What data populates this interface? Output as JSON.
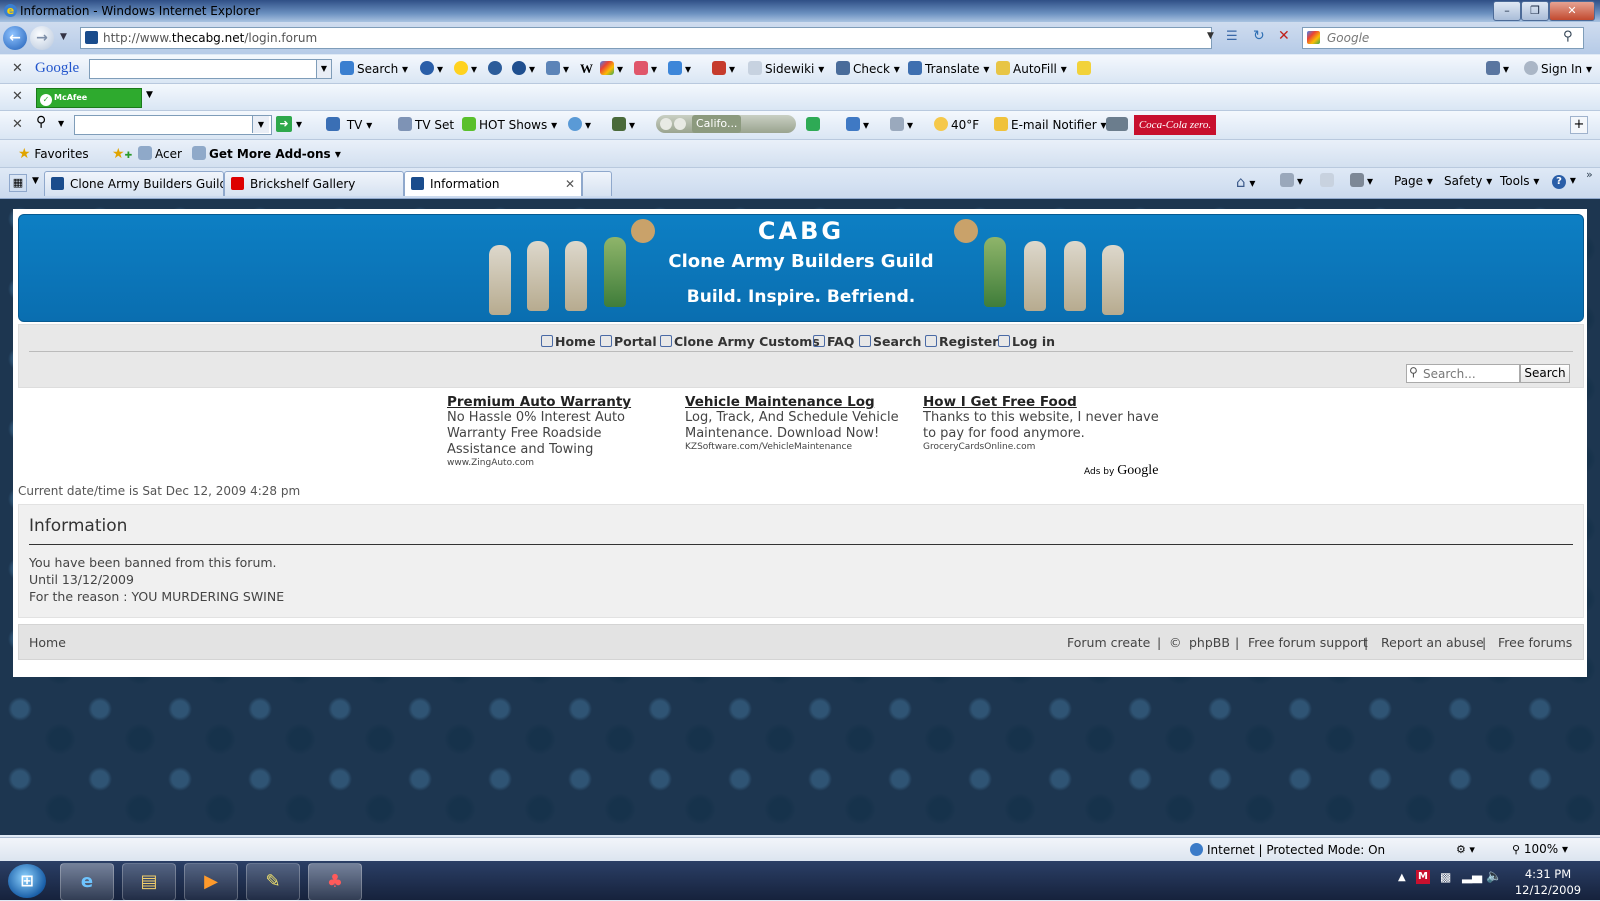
{
  "window": {
    "title": "Information - Windows Internet Explorer"
  },
  "address": {
    "url_prefix": "http://www.",
    "url_domain": "thecabg.net",
    "url_path": "/login.forum",
    "search_placeholder": "Google"
  },
  "google_toolbar": {
    "logo": "Google",
    "search_label": "Search",
    "wiki_label": "W",
    "sidewiki_label": "Sidewiki",
    "check_label": "Check",
    "translate_label": "Translate",
    "autofill_label": "AutoFill",
    "signin_label": "Sign In"
  },
  "mcafee_toolbar": {
    "label": "McAfee SiteAdvisor"
  },
  "community_toolbar": {
    "tv_label": "TV",
    "tvset_label": "TV Set",
    "hotshows_label": "HOT Shows",
    "radio_label": "Califo...",
    "weather_label": "40°F",
    "email_label": "E-mail Notifier",
    "brand_label": "Coca-Cola zero."
  },
  "favorites_bar": {
    "favorites_label": "Favorites",
    "acer_label": "Acer",
    "addons_label": "Get More Add-ons"
  },
  "tabs": [
    {
      "label": "Clone Army Builders Guild",
      "color": "#1a4c8c"
    },
    {
      "label": "Brickshelf Gallery",
      "color": "#dd0000"
    },
    {
      "label": "Information",
      "color": "#1a4c8c"
    }
  ],
  "command_bar": {
    "page_label": "Page",
    "safety_label": "Safety",
    "tools_label": "Tools"
  },
  "banner": {
    "logo": "CABG",
    "title": "Clone Army Builders Guild",
    "tagline": "Build. Inspire. Befriend."
  },
  "nav": {
    "home": "Home",
    "portal": "Portal",
    "customs": "Clone Army Customs",
    "faq": "FAQ",
    "search": "Search",
    "register": "Register",
    "login": "Log in"
  },
  "forum_search": {
    "placeholder": "Search...",
    "button": "Search"
  },
  "ads": [
    {
      "title": "Premium Auto Warranty",
      "desc": "No Hassle 0% Interest Auto Warranty Free Roadside Assistance and Towing",
      "site": "www.ZingAuto.com"
    },
    {
      "title": "Vehicle Maintenance Log",
      "desc": "Log, Track, And Schedule Vehicle Maintenance. Download Now!",
      "site": "KZSoftware.com/VehicleMaintenance"
    },
    {
      "title": "How I Get Free Food",
      "desc": "Thanks to this website, I never have to pay for food anymore.",
      "site": "GroceryCardsOnline.com"
    }
  ],
  "ads_by": {
    "prefix": "Ads by",
    "brand": "Google"
  },
  "current_date": "Current date/time is Sat Dec 12, 2009 4:28 pm",
  "info": {
    "heading": "Information",
    "line1": "You have been banned from this forum.",
    "line2": "Until 13/12/2009",
    "line3": "For the reason : YOU MURDERING SWINE"
  },
  "footer": {
    "home": "Home",
    "forum_create": "Forum create",
    "copyright": "©",
    "phpbb": "phpBB",
    "support": "Free forum support",
    "abuse": "Report an abuse",
    "free_forums": "Free forums",
    "sep": "|"
  },
  "status": {
    "zone": "Internet | Protected Mode: On",
    "zoom": "100%"
  },
  "clock": {
    "time": "4:31 PM",
    "date": "12/12/2009"
  },
  "colors": {
    "banner": "#0a78bd",
    "page_bg": "#1d3650"
  }
}
